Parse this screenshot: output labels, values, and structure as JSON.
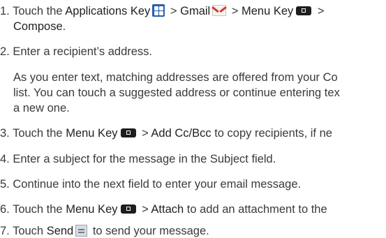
{
  "steps": [
    {
      "number": "1.",
      "parts": {
        "t1": "Touch the ",
        "applications_key": "Applications Key",
        "sep1": " > ",
        "gmail": "Gmail",
        "sep2": " > ",
        "menu_key": "Menu Key",
        "sep3": " >",
        "compose": "Compose",
        "end": "."
      }
    },
    {
      "number": "2.",
      "text": "Enter a recipient’s address.",
      "note_line1": "As you enter text, matching addresses are offered from your Co",
      "note_line2": "list. You can touch a suggested address or continue entering tex",
      "note_line3": "a new one."
    },
    {
      "number": "3.",
      "parts": {
        "t1": "Touch the ",
        "menu_key": "Menu Key",
        "sep1": " > ",
        "add_cc_bcc": "Add Cc/Bcc",
        "t2": " to copy recipients, if ne"
      }
    },
    {
      "number": "4.",
      "text": "Enter a subject for the message in the Subject field."
    },
    {
      "number": "5.",
      "text": "Continue into the next field to enter your email message."
    },
    {
      "number": "6.",
      "parts": {
        "t1": "Touch the ",
        "menu_key": "Menu Key",
        "sep1": " > ",
        "attach": "Attach",
        "t2": " to add an attachment to the"
      }
    },
    {
      "number": "7.",
      "parts": {
        "t1": "Touch ",
        "send": "Send",
        "t2": " to send your message."
      }
    }
  ],
  "icons": {
    "applications_key": "apps-grid-icon",
    "gmail": "gmail-envelope-icon",
    "menu_key": "menu-key-icon",
    "send": "send-icon"
  }
}
